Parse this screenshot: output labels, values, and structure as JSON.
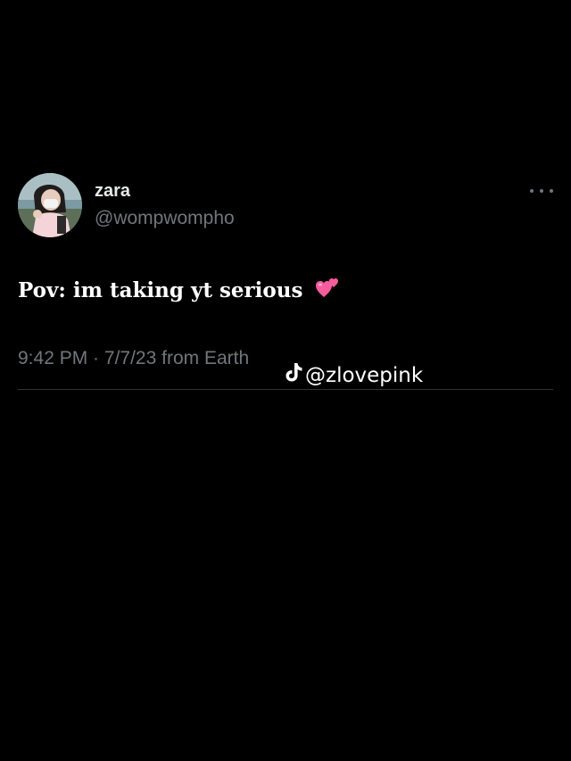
{
  "tweet": {
    "author": {
      "display_name": "zara",
      "handle": "@wompwompho",
      "avatar_icon": "profile-photo"
    },
    "text": "Pov: im taking yt serious",
    "emoji": "two-hearts-emoji",
    "time": "9:42 PM",
    "separator": " · ",
    "date": "7/7/23",
    "source": " from Earth",
    "more_icon": "more-horizontal-icon"
  },
  "watermark": {
    "platform_icon": "tiktok-icon",
    "username": "@zlovepink"
  },
  "colors": {
    "background": "#000000",
    "primary_text": "#ffffff",
    "secondary_text": "#71767b",
    "divider": "#2f3336",
    "emoji_pink": "#f75c9e"
  }
}
